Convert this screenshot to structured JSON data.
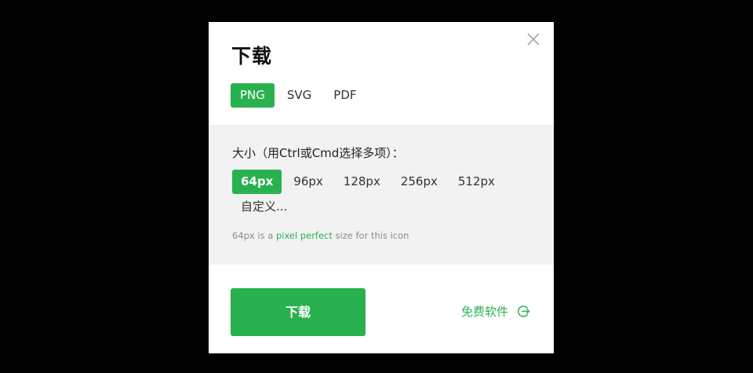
{
  "dialog": {
    "title": "下载",
    "formats": [
      {
        "label": "PNG",
        "active": true
      },
      {
        "label": "SVG",
        "active": false
      },
      {
        "label": "PDF",
        "active": false
      }
    ],
    "size_label": "大小（用Ctrl或Cmd选择多项）：",
    "sizes": [
      {
        "label": "64px",
        "active": true
      },
      {
        "label": "96px",
        "active": false
      },
      {
        "label": "128px",
        "active": false
      },
      {
        "label": "256px",
        "active": false
      },
      {
        "label": "512px",
        "active": false
      },
      {
        "label": "自定义...",
        "active": false
      }
    ],
    "hint": {
      "prefix": "64px is a ",
      "link": "pixel perfect",
      "suffix": " size for this icon"
    },
    "download_label": "下载",
    "free_software_label": "免费软件",
    "icons": {
      "close": "close-icon",
      "free_software": "arrow-right-circle-icon"
    },
    "colors": {
      "accent": "#2ab14f",
      "panel": "#f2f2f2",
      "backdrop": "#000000"
    }
  }
}
